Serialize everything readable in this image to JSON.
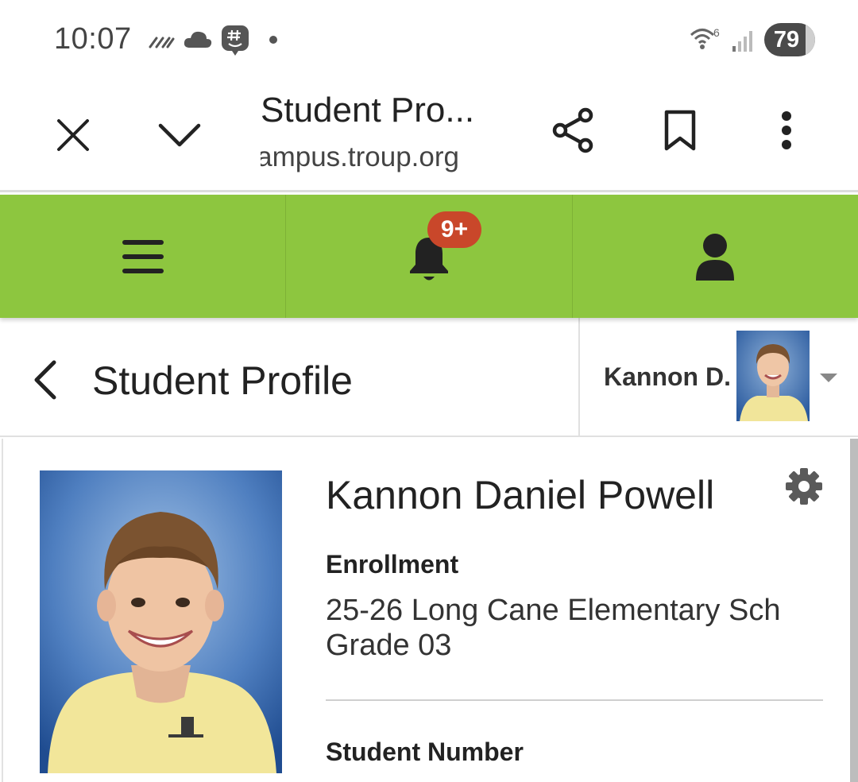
{
  "status_bar": {
    "time": "10:07",
    "battery": "79",
    "icons": [
      "data-traffic-icon",
      "cloud-icon",
      "groupme-icon",
      "dot-icon",
      "wifi-icon",
      "signal-icon",
      "battery-icon"
    ]
  },
  "browser": {
    "title": "Student Pro...",
    "url": "campus.troup.org",
    "icons": [
      "close-icon",
      "chevron-down-icon",
      "share-icon",
      "bookmark-icon",
      "more-vert-icon"
    ]
  },
  "app_nav": {
    "notification_count": "9+",
    "accent_color": "#8dc63f",
    "badge_color": "#c9472a",
    "icons": [
      "menu-icon",
      "bell-icon",
      "user-icon"
    ]
  },
  "page": {
    "title": "Student Profile",
    "selected_student": "Kannon D."
  },
  "profile": {
    "name": "Kannon Daniel Powell",
    "enrollment_label": "Enrollment",
    "enrollment_school": "25-26 Long Cane Elementary Sch",
    "enrollment_grade": "Grade 03",
    "student_number_label": "Student Number"
  }
}
